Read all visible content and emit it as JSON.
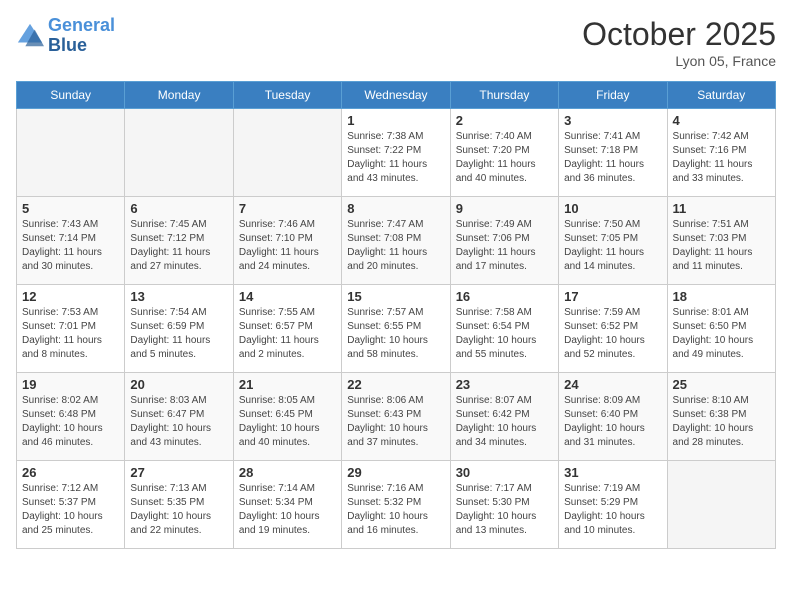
{
  "header": {
    "logo_line1": "General",
    "logo_line2": "Blue",
    "month": "October 2025",
    "location": "Lyon 05, France"
  },
  "days_of_week": [
    "Sunday",
    "Monday",
    "Tuesday",
    "Wednesday",
    "Thursday",
    "Friday",
    "Saturday"
  ],
  "weeks": [
    [
      {
        "day": "",
        "info": ""
      },
      {
        "day": "",
        "info": ""
      },
      {
        "day": "",
        "info": ""
      },
      {
        "day": "1",
        "info": "Sunrise: 7:38 AM\nSunset: 7:22 PM\nDaylight: 11 hours\nand 43 minutes."
      },
      {
        "day": "2",
        "info": "Sunrise: 7:40 AM\nSunset: 7:20 PM\nDaylight: 11 hours\nand 40 minutes."
      },
      {
        "day": "3",
        "info": "Sunrise: 7:41 AM\nSunset: 7:18 PM\nDaylight: 11 hours\nand 36 minutes."
      },
      {
        "day": "4",
        "info": "Sunrise: 7:42 AM\nSunset: 7:16 PM\nDaylight: 11 hours\nand 33 minutes."
      }
    ],
    [
      {
        "day": "5",
        "info": "Sunrise: 7:43 AM\nSunset: 7:14 PM\nDaylight: 11 hours\nand 30 minutes."
      },
      {
        "day": "6",
        "info": "Sunrise: 7:45 AM\nSunset: 7:12 PM\nDaylight: 11 hours\nand 27 minutes."
      },
      {
        "day": "7",
        "info": "Sunrise: 7:46 AM\nSunset: 7:10 PM\nDaylight: 11 hours\nand 24 minutes."
      },
      {
        "day": "8",
        "info": "Sunrise: 7:47 AM\nSunset: 7:08 PM\nDaylight: 11 hours\nand 20 minutes."
      },
      {
        "day": "9",
        "info": "Sunrise: 7:49 AM\nSunset: 7:06 PM\nDaylight: 11 hours\nand 17 minutes."
      },
      {
        "day": "10",
        "info": "Sunrise: 7:50 AM\nSunset: 7:05 PM\nDaylight: 11 hours\nand 14 minutes."
      },
      {
        "day": "11",
        "info": "Sunrise: 7:51 AM\nSunset: 7:03 PM\nDaylight: 11 hours\nand 11 minutes."
      }
    ],
    [
      {
        "day": "12",
        "info": "Sunrise: 7:53 AM\nSunset: 7:01 PM\nDaylight: 11 hours\nand 8 minutes."
      },
      {
        "day": "13",
        "info": "Sunrise: 7:54 AM\nSunset: 6:59 PM\nDaylight: 11 hours\nand 5 minutes."
      },
      {
        "day": "14",
        "info": "Sunrise: 7:55 AM\nSunset: 6:57 PM\nDaylight: 11 hours\nand 2 minutes."
      },
      {
        "day": "15",
        "info": "Sunrise: 7:57 AM\nSunset: 6:55 PM\nDaylight: 10 hours\nand 58 minutes."
      },
      {
        "day": "16",
        "info": "Sunrise: 7:58 AM\nSunset: 6:54 PM\nDaylight: 10 hours\nand 55 minutes."
      },
      {
        "day": "17",
        "info": "Sunrise: 7:59 AM\nSunset: 6:52 PM\nDaylight: 10 hours\nand 52 minutes."
      },
      {
        "day": "18",
        "info": "Sunrise: 8:01 AM\nSunset: 6:50 PM\nDaylight: 10 hours\nand 49 minutes."
      }
    ],
    [
      {
        "day": "19",
        "info": "Sunrise: 8:02 AM\nSunset: 6:48 PM\nDaylight: 10 hours\nand 46 minutes."
      },
      {
        "day": "20",
        "info": "Sunrise: 8:03 AM\nSunset: 6:47 PM\nDaylight: 10 hours\nand 43 minutes."
      },
      {
        "day": "21",
        "info": "Sunrise: 8:05 AM\nSunset: 6:45 PM\nDaylight: 10 hours\nand 40 minutes."
      },
      {
        "day": "22",
        "info": "Sunrise: 8:06 AM\nSunset: 6:43 PM\nDaylight: 10 hours\nand 37 minutes."
      },
      {
        "day": "23",
        "info": "Sunrise: 8:07 AM\nSunset: 6:42 PM\nDaylight: 10 hours\nand 34 minutes."
      },
      {
        "day": "24",
        "info": "Sunrise: 8:09 AM\nSunset: 6:40 PM\nDaylight: 10 hours\nand 31 minutes."
      },
      {
        "day": "25",
        "info": "Sunrise: 8:10 AM\nSunset: 6:38 PM\nDaylight: 10 hours\nand 28 minutes."
      }
    ],
    [
      {
        "day": "26",
        "info": "Sunrise: 7:12 AM\nSunset: 5:37 PM\nDaylight: 10 hours\nand 25 minutes."
      },
      {
        "day": "27",
        "info": "Sunrise: 7:13 AM\nSunset: 5:35 PM\nDaylight: 10 hours\nand 22 minutes."
      },
      {
        "day": "28",
        "info": "Sunrise: 7:14 AM\nSunset: 5:34 PM\nDaylight: 10 hours\nand 19 minutes."
      },
      {
        "day": "29",
        "info": "Sunrise: 7:16 AM\nSunset: 5:32 PM\nDaylight: 10 hours\nand 16 minutes."
      },
      {
        "day": "30",
        "info": "Sunrise: 7:17 AM\nSunset: 5:30 PM\nDaylight: 10 hours\nand 13 minutes."
      },
      {
        "day": "31",
        "info": "Sunrise: 7:19 AM\nSunset: 5:29 PM\nDaylight: 10 hours\nand 10 minutes."
      },
      {
        "day": "",
        "info": ""
      }
    ]
  ]
}
